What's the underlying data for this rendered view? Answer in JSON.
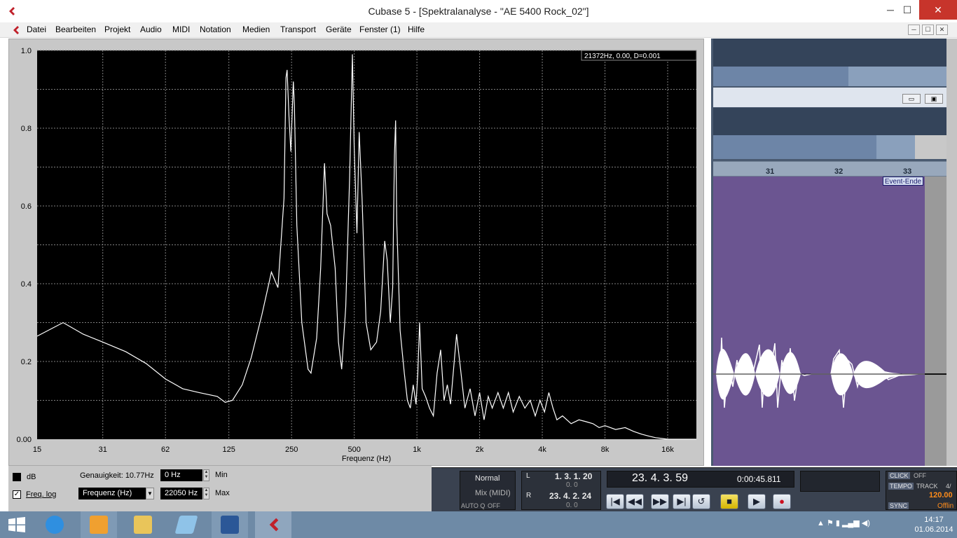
{
  "window": {
    "title": "Cubase 5 - [Spektralanalyse - \"AE 5400 Rock_02\"]",
    "minimize": "─",
    "maximize": "☐",
    "close": "✕"
  },
  "menu": [
    "Datei",
    "Bearbeiten",
    "Projekt",
    "Audio",
    "MIDI",
    "Notation",
    "Medien",
    "Transport",
    "Geräte",
    "Fenster (1)",
    "Hilfe"
  ],
  "analysis": {
    "readout": "21372Hz, 0.00, D=0.001",
    "options": {
      "db_label": "dB",
      "db_checked": false,
      "freq_log_label": "Freq. log",
      "freq_log_checked": true,
      "accuracy": "Genauigkeit: 10.77Hz",
      "mode_value": "Frequenz (Hz)",
      "min_value": "0 Hz",
      "min_label": "Min",
      "max_value": "22050 Hz",
      "max_label": "Max"
    }
  },
  "chart_data": {
    "type": "line",
    "xlabel": "Frequenz (Hz)",
    "ylabel": "",
    "x_scale": "log",
    "xlim": [
      15,
      22050
    ],
    "ylim": [
      0,
      1.0
    ],
    "x_ticks": [
      "15",
      "31",
      "62",
      "125",
      "250",
      "500",
      "1k",
      "2k",
      "4k",
      "8k",
      "16k"
    ],
    "x_tick_values": [
      15,
      31,
      62,
      125,
      250,
      500,
      1000,
      2000,
      4000,
      8000,
      16000
    ],
    "y_ticks": [
      "0.00",
      "0.2",
      "0.4",
      "0.6",
      "0.8",
      "1.0"
    ],
    "y_tick_values": [
      0,
      0.2,
      0.4,
      0.6,
      0.8,
      1.0
    ],
    "grid": true,
    "series": [
      {
        "points": [
          [
            15,
            0.265
          ],
          [
            20,
            0.3
          ],
          [
            25,
            0.27
          ],
          [
            31,
            0.25
          ],
          [
            40,
            0.225
          ],
          [
            50,
            0.195
          ],
          [
            62,
            0.155
          ],
          [
            75,
            0.13
          ],
          [
            90,
            0.12
          ],
          [
            110,
            0.11
          ],
          [
            120,
            0.095
          ],
          [
            130,
            0.1
          ],
          [
            145,
            0.14
          ],
          [
            160,
            0.21
          ],
          [
            180,
            0.32
          ],
          [
            200,
            0.43
          ],
          [
            215,
            0.39
          ],
          [
            230,
            0.62
          ],
          [
            235,
            0.93
          ],
          [
            238,
            0.95
          ],
          [
            243,
            0.83
          ],
          [
            248,
            0.74
          ],
          [
            255,
            0.92
          ],
          [
            258,
            0.86
          ],
          [
            265,
            0.55
          ],
          [
            280,
            0.3
          ],
          [
            300,
            0.18
          ],
          [
            310,
            0.17
          ],
          [
            330,
            0.26
          ],
          [
            345,
            0.44
          ],
          [
            360,
            0.71
          ],
          [
            370,
            0.58
          ],
          [
            385,
            0.55
          ],
          [
            405,
            0.44
          ],
          [
            420,
            0.25
          ],
          [
            435,
            0.18
          ],
          [
            455,
            0.34
          ],
          [
            475,
            0.67
          ],
          [
            490,
            0.99
          ],
          [
            500,
            0.75
          ],
          [
            515,
            0.53
          ],
          [
            528,
            0.79
          ],
          [
            545,
            0.62
          ],
          [
            570,
            0.3
          ],
          [
            600,
            0.23
          ],
          [
            640,
            0.25
          ],
          [
            670,
            0.33
          ],
          [
            700,
            0.51
          ],
          [
            720,
            0.46
          ],
          [
            745,
            0.3
          ],
          [
            765,
            0.39
          ],
          [
            780,
            0.73
          ],
          [
            790,
            0.82
          ],
          [
            800,
            0.56
          ],
          [
            830,
            0.28
          ],
          [
            870,
            0.17
          ],
          [
            900,
            0.1
          ],
          [
            930,
            0.08
          ],
          [
            960,
            0.14
          ],
          [
            990,
            0.09
          ],
          [
            1010,
            0.17
          ],
          [
            1030,
            0.3
          ],
          [
            1060,
            0.13
          ],
          [
            1100,
            0.11
          ],
          [
            1150,
            0.08
          ],
          [
            1200,
            0.06
          ],
          [
            1250,
            0.17
          ],
          [
            1300,
            0.23
          ],
          [
            1350,
            0.1
          ],
          [
            1400,
            0.14
          ],
          [
            1450,
            0.09
          ],
          [
            1500,
            0.18
          ],
          [
            1550,
            0.27
          ],
          [
            1620,
            0.18
          ],
          [
            1700,
            0.08
          ],
          [
            1800,
            0.13
          ],
          [
            1900,
            0.06
          ],
          [
            2000,
            0.12
          ],
          [
            2100,
            0.05
          ],
          [
            2200,
            0.11
          ],
          [
            2300,
            0.08
          ],
          [
            2450,
            0.12
          ],
          [
            2600,
            0.08
          ],
          [
            2750,
            0.12
          ],
          [
            2900,
            0.07
          ],
          [
            3100,
            0.11
          ],
          [
            3300,
            0.08
          ],
          [
            3500,
            0.1
          ],
          [
            3700,
            0.06
          ],
          [
            3900,
            0.1
          ],
          [
            4100,
            0.07
          ],
          [
            4300,
            0.12
          ],
          [
            4500,
            0.08
          ],
          [
            4700,
            0.05
          ],
          [
            5000,
            0.06
          ],
          [
            5500,
            0.04
          ],
          [
            6000,
            0.05
          ],
          [
            6500,
            0.045
          ],
          [
            7000,
            0.04
          ],
          [
            7500,
            0.03
          ],
          [
            8000,
            0.035
          ],
          [
            9000,
            0.025
          ],
          [
            10000,
            0.03
          ],
          [
            11000,
            0.02
          ],
          [
            12000,
            0.013
          ],
          [
            13000,
            0.008
          ],
          [
            14000,
            0.004
          ],
          [
            15000,
            0.002
          ],
          [
            16000,
            0.0
          ],
          [
            22050,
            0.0
          ]
        ]
      }
    ]
  },
  "arrange": {
    "ruler_labels": [
      "31",
      "32",
      "33"
    ],
    "event_end_label": "Event-Ende",
    "window_btn_min": "▭",
    "window_btn_max": "▣"
  },
  "transport": {
    "mode_normal": "Normal",
    "mode_mix": "Mix (MIDI)",
    "autoq_label": "AUTO Q",
    "autoq_value": "OFF",
    "left_locator_label": "L",
    "left_locator": "1. 3. 1. 20",
    "left_locator_sub": "0.   0",
    "right_locator_label": "R",
    "right_locator": "23. 4. 2. 24",
    "right_locator_sub": "0.   0",
    "position": "23. 4. 3. 59",
    "time": "0:00:45.811",
    "click_label": "CLICK",
    "click_value": "OFF",
    "tempo_label": "TEMPO",
    "tempo_mode": "TRACK",
    "tempo_sig": "4/",
    "tempo_value": "120.00",
    "sync_label": "SYNC",
    "sync_value": "Offlin",
    "buttons": [
      "|◀",
      "◀◀",
      "▶▶",
      "▶|",
      "↺",
      "■",
      "▶",
      "●"
    ]
  },
  "taskbar": {
    "time": "14:17",
    "date": "01.06.2014"
  }
}
